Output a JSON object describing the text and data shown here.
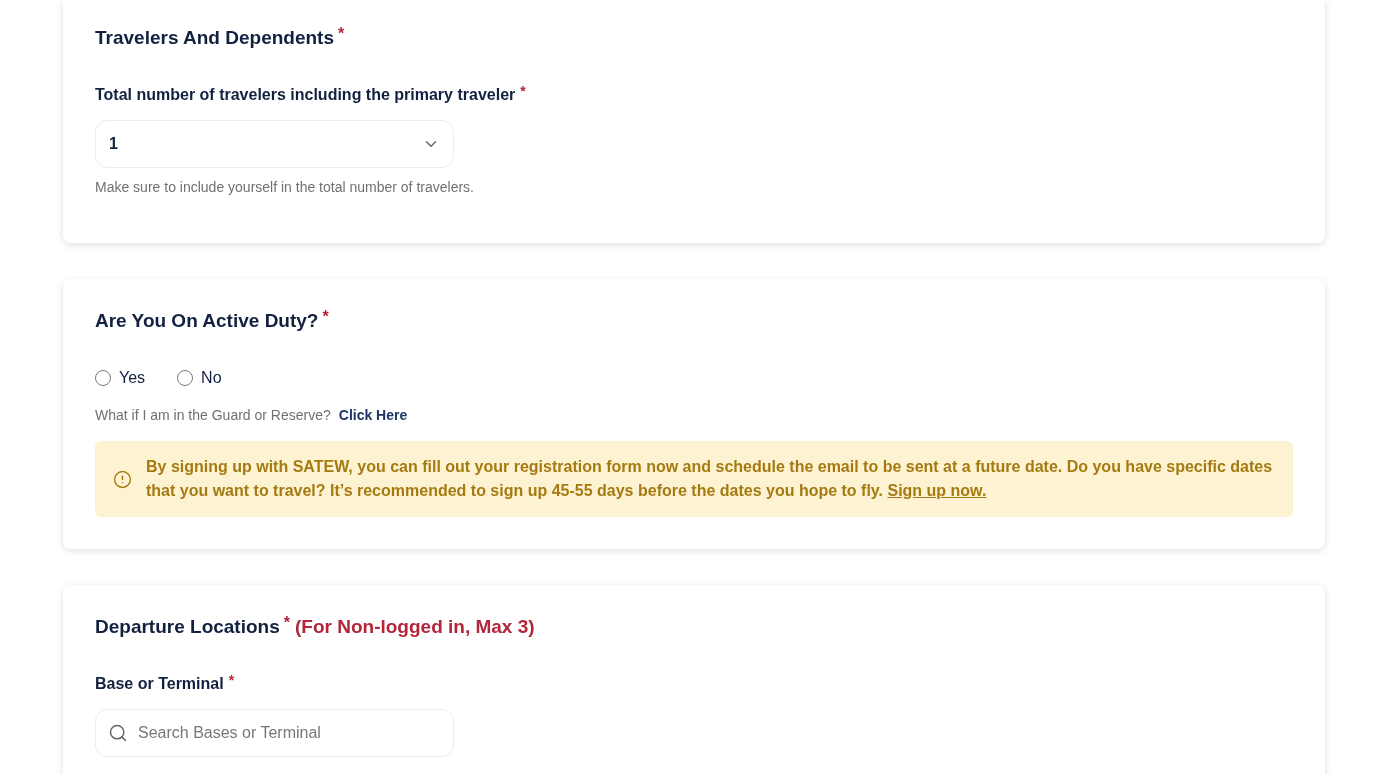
{
  "sections": [
    {
      "kind": "dropdown",
      "title": "Travelers And Dependents",
      "mark": "*",
      "field": {
        "label": "Total number of travelers including the primary traveler",
        "mark": "*",
        "value": "1",
        "help": "Make sure to include yourself in the total number of travelers."
      }
    },
    {
      "kind": "radio",
      "title": "Are You On Active Duty?",
      "mark": "*",
      "options": [
        {
          "label": "Yes",
          "selected": false
        },
        {
          "label": "No",
          "selected": false
        }
      ],
      "hint": "What if I am in the Guard or Reserve?",
      "link": "Click Here",
      "alert": {
        "text": "By signing up with SATEW, you can fill out your registration form now and schedule the email to be sent at a future date. Do you have specific dates that you want to travel? It’s recommended to sign up 45-55 days before the dates you hope to fly.",
        "link": "Sign up now."
      }
    },
    {
      "kind": "search",
      "title": "Departure Locations",
      "mark": "*",
      "note": "(For Non-logged in, Max 3)",
      "field": {
        "label": "Base or Terminal",
        "mark": "*",
        "placeholder": "Search Bases or Terminal"
      }
    }
  ]
}
